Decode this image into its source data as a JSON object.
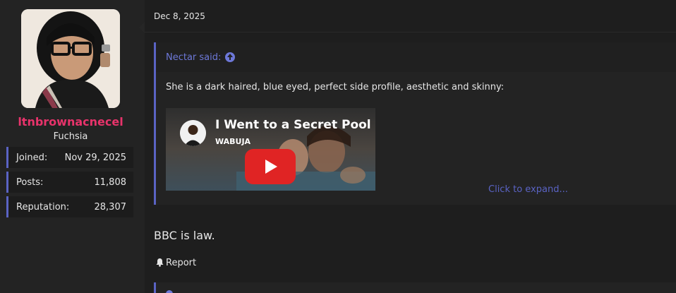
{
  "user": {
    "username": "ltnbrownacnecel",
    "title": "Fuchsia",
    "stats": [
      {
        "label": "Joined:",
        "value": "Nov 29, 2025"
      },
      {
        "label": "Posts:",
        "value": "11,808"
      },
      {
        "label": "Reputation:",
        "value": "28,307"
      }
    ]
  },
  "post": {
    "date": "Dec 8, 2025",
    "quote": {
      "author": "Nectar said:",
      "text": "She is a dark haired, blue eyed, perfect side profile, aesthetic and skinny:",
      "video": {
        "title": "I Went to a Secret Pool I",
        "channel": "WABUJA"
      },
      "expand_label": "Click to expand..."
    },
    "body": "BBC is law.",
    "report_label": "Report"
  },
  "colors": {
    "accent": "#5a63c4",
    "username": "#e8336b",
    "background": "#1e1e1e",
    "panel": "#232323"
  },
  "icons": {
    "quote_jump": "arrow-up-circle-icon",
    "report": "bell-icon",
    "play": "play-icon"
  }
}
